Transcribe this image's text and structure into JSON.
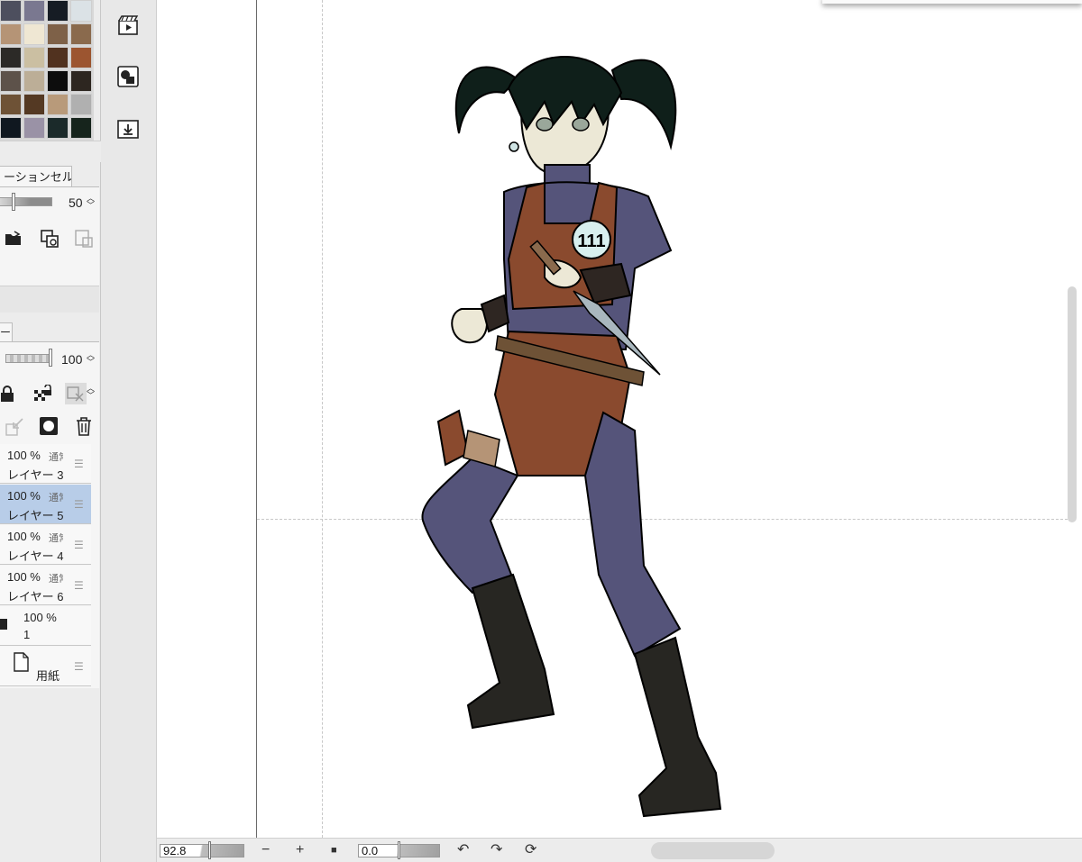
{
  "palette": {
    "colors": [
      "#4d4f5e",
      "#7a7890",
      "#161c24",
      "#dbe2e6",
      "#b59476",
      "#efe7d3",
      "#7e6148",
      "#8a6a4d",
      "#2c2a27",
      "#cbbfa2",
      "#51321f",
      "#9c5530",
      "#5d524a",
      "#bcae97",
      "#0d0d0d",
      "#2d2620",
      "#6e5236",
      "#543923",
      "#b89a7a",
      "#b0b0b0",
      "#101820",
      "#9a92a6",
      "#1b2a2a",
      "#16241c"
    ]
  },
  "animation_panel": {
    "tab_label": "ーションセル",
    "opacity_value": "50"
  },
  "layer_panel": {
    "tab_label": "ー",
    "opacity_value": "100",
    "layers": [
      {
        "percent": "100 %",
        "mode": "通常",
        "name": "レイヤー 3",
        "selected": false
      },
      {
        "percent": "100 %",
        "mode": "通常",
        "name": "レイヤー 5",
        "selected": true
      },
      {
        "percent": "100 %",
        "mode": "通常",
        "name": "レイヤー 4",
        "selected": false
      },
      {
        "percent": "100 %",
        "mode": "通常",
        "name": "レイヤー 6",
        "selected": false
      },
      {
        "percent": "100 %",
        "mode": "",
        "name": "1",
        "selected": false
      }
    ],
    "paper_label": "用紙"
  },
  "bottom_bar": {
    "zoom_value": "92.8",
    "zoom_out_label": "−",
    "zoom_in_label": "+",
    "fit_label": "■",
    "rotation_value": "0.0",
    "rotate_left_label": "↶",
    "rotate_right_label": "↷",
    "reset_label": "⟳"
  },
  "canvas": {
    "badge_number": "111"
  }
}
